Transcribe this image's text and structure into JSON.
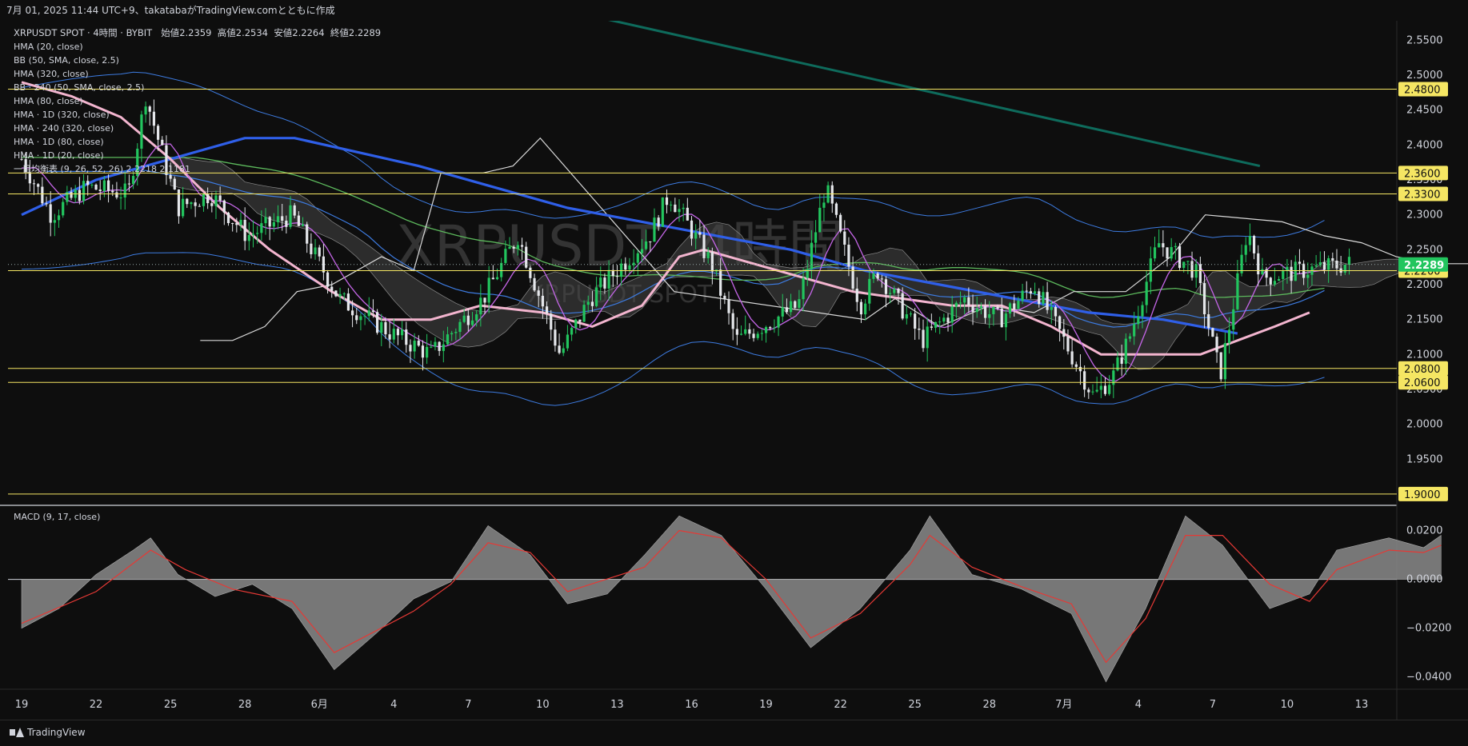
{
  "header": {
    "attribution": "7月 01, 2025 11:44 UTC+9、takatabaがTradingView.comとともに作成"
  },
  "legend": {
    "symbol_line": "XRPUSDT SPOT · 4時間 · BYBIT",
    "open_label": "始値",
    "open": "2.2359",
    "high_label": "高値",
    "high": "2.2534",
    "low_label": "安値",
    "low": "2.2264",
    "close_label": "終値",
    "close": "2.2289",
    "indicators": [
      "HMA (20, close)",
      "BB (50, SMA, close, 2.5)",
      "HMA (320, close)",
      "BB · 240 (50, SMA, close, 2.5)",
      "HMA (80, close)",
      "HMA · 1D (320, close)",
      "HMA · 240 (320, close)",
      "HMA · 1D (80, close)",
      "HMA · 1D (20, close)",
      "一目均衡表 (9, 26, 52, 26)  2.2218  2.1181"
    ]
  },
  "watermark": {
    "main": "XRPUSDT, 4時間",
    "sub": "XRPUSDT SPOT"
  },
  "macd_label": "MACD (9, 17, close)",
  "footer": {
    "brand": "TradingView"
  },
  "colors": {
    "up": "#22c55e",
    "down": "#e5e7eb",
    "level": "#f5e663",
    "hma320": "#2f5fe8",
    "hma80": "#f3b5cf",
    "hma20": "#c566e8",
    "bb": "#3d7be0",
    "bb240": "#3d7be0",
    "green_ma": "#5cb85c",
    "trendline": "#0e6b5c",
    "macd_line": "#e53935",
    "macd_hist": "#8a8a8a"
  },
  "chart_data": [
    {
      "type": "candlestick",
      "title": "XRPUSDT SPOT · 4時間 · BYBIT",
      "x_tick_labels": [
        "19",
        "22",
        "25",
        "28",
        "6月",
        "4",
        "7",
        "10",
        "13",
        "16",
        "19",
        "22",
        "25",
        "28",
        "7月",
        "4",
        "7",
        "10",
        "13"
      ],
      "ylim": [
        1.885,
        2.578
      ],
      "y_ticks": [
        "2.5500",
        "2.5000",
        "2.4500",
        "2.4000",
        "2.3500",
        "2.3000",
        "2.2500",
        "2.2000",
        "2.1500",
        "2.1000",
        "2.0500",
        "2.0000",
        "1.9500",
        "1.9000"
      ],
      "price_levels": [
        2.48,
        2.36,
        2.33,
        2.22,
        2.08,
        2.06,
        1.9
      ],
      "level_labels": [
        "2.4800",
        "2.3600",
        "2.3300",
        "2.2200",
        "2.0800",
        "2.0600",
        "1.9000"
      ],
      "current_price": 2.2289,
      "current_price_label": "2.2289",
      "trend_line": [
        [
          23.6,
          2.58
        ],
        [
          49.9,
          2.37
        ]
      ],
      "price_path": [
        [
          0,
          2.38
        ],
        [
          1.2,
          2.3
        ],
        [
          2.6,
          2.34
        ],
        [
          4.3,
          2.33
        ],
        [
          5.0,
          2.47
        ],
        [
          6.3,
          2.31
        ],
        [
          7.6,
          2.33
        ],
        [
          9.1,
          2.27
        ],
        [
          10.9,
          2.3
        ],
        [
          12.8,
          2.18
        ],
        [
          14.9,
          2.13
        ],
        [
          16.5,
          2.1
        ],
        [
          18.6,
          2.18
        ],
        [
          20.0,
          2.27
        ],
        [
          21.7,
          2.1
        ],
        [
          22.9,
          2.18
        ],
        [
          25.3,
          2.27
        ],
        [
          26.1,
          2.33
        ],
        [
          27.8,
          2.23
        ],
        [
          28.8,
          2.12
        ],
        [
          31.3,
          2.17
        ],
        [
          32.4,
          2.34
        ],
        [
          33.8,
          2.17
        ],
        [
          34.5,
          2.22
        ],
        [
          36.3,
          2.12
        ],
        [
          38.0,
          2.18
        ],
        [
          39.4,
          2.15
        ],
        [
          40.8,
          2.2
        ],
        [
          43.2,
          2.04
        ],
        [
          44.0,
          2.07
        ],
        [
          44.7,
          2.13
        ],
        [
          45.8,
          2.26
        ],
        [
          47.3,
          2.22
        ],
        [
          48.3,
          2.07
        ],
        [
          49.4,
          2.28
        ],
        [
          50.0,
          2.21
        ],
        [
          51.6,
          2.22
        ],
        [
          53.5,
          2.23
        ]
      ]
    },
    {
      "type": "area",
      "title": "MACD (9, 17, close)",
      "ylim": [
        -0.045,
        0.03
      ],
      "y_ticks": [
        "0.0200",
        "0.0000",
        "−0.0200",
        "−0.0400"
      ],
      "histogram": [
        [
          0,
          -0.02
        ],
        [
          1.5,
          -0.012
        ],
        [
          3,
          0.002
        ],
        [
          4.5,
          0.012
        ],
        [
          5.2,
          0.017
        ],
        [
          6.3,
          0.002
        ],
        [
          7.8,
          -0.007
        ],
        [
          9.3,
          -0.002
        ],
        [
          10.9,
          -0.012
        ],
        [
          12.6,
          -0.037
        ],
        [
          14.3,
          -0.022
        ],
        [
          15.8,
          -0.008
        ],
        [
          17.3,
          -0.001
        ],
        [
          18.8,
          0.022
        ],
        [
          20.5,
          0.01
        ],
        [
          22.0,
          -0.01
        ],
        [
          23.6,
          -0.006
        ],
        [
          25.1,
          0.01
        ],
        [
          26.5,
          0.026
        ],
        [
          28.2,
          0.018
        ],
        [
          30.0,
          -0.004
        ],
        [
          31.8,
          -0.028
        ],
        [
          33.8,
          -0.012
        ],
        [
          35.8,
          0.012
        ],
        [
          36.6,
          0.026
        ],
        [
          38.3,
          0.002
        ],
        [
          40.3,
          -0.004
        ],
        [
          42.3,
          -0.014
        ],
        [
          43.7,
          -0.042
        ],
        [
          45.3,
          -0.012
        ],
        [
          46.9,
          0.026
        ],
        [
          48.4,
          0.014
        ],
        [
          50.3,
          -0.012
        ],
        [
          51.9,
          -0.006
        ],
        [
          53.0,
          0.012
        ],
        [
          55.1,
          0.017
        ],
        [
          56.5,
          0.013
        ],
        [
          57.2,
          0.018
        ]
      ],
      "signal": [
        [
          0,
          -0.018
        ],
        [
          3,
          -0.005
        ],
        [
          5.2,
          0.012
        ],
        [
          6.6,
          0.004
        ],
        [
          8.5,
          -0.004
        ],
        [
          10.9,
          -0.009
        ],
        [
          12.6,
          -0.03
        ],
        [
          15.8,
          -0.013
        ],
        [
          17.3,
          -0.002
        ],
        [
          18.8,
          0.015
        ],
        [
          20.5,
          0.011
        ],
        [
          22.0,
          -0.005
        ],
        [
          25.1,
          0.005
        ],
        [
          26.5,
          0.02
        ],
        [
          28.2,
          0.017
        ],
        [
          30.0,
          0.0
        ],
        [
          31.8,
          -0.024
        ],
        [
          33.8,
          -0.014
        ],
        [
          35.8,
          0.006
        ],
        [
          36.6,
          0.018
        ],
        [
          38.3,
          0.005
        ],
        [
          40.3,
          -0.003
        ],
        [
          42.3,
          -0.01
        ],
        [
          43.7,
          -0.034
        ],
        [
          45.3,
          -0.016
        ],
        [
          46.9,
          0.018
        ],
        [
          48.4,
          0.018
        ],
        [
          50.3,
          -0.002
        ],
        [
          51.9,
          -0.009
        ],
        [
          53.0,
          0.004
        ],
        [
          55.1,
          0.012
        ],
        [
          56.5,
          0.011
        ],
        [
          57.2,
          0.014
        ]
      ]
    }
  ]
}
